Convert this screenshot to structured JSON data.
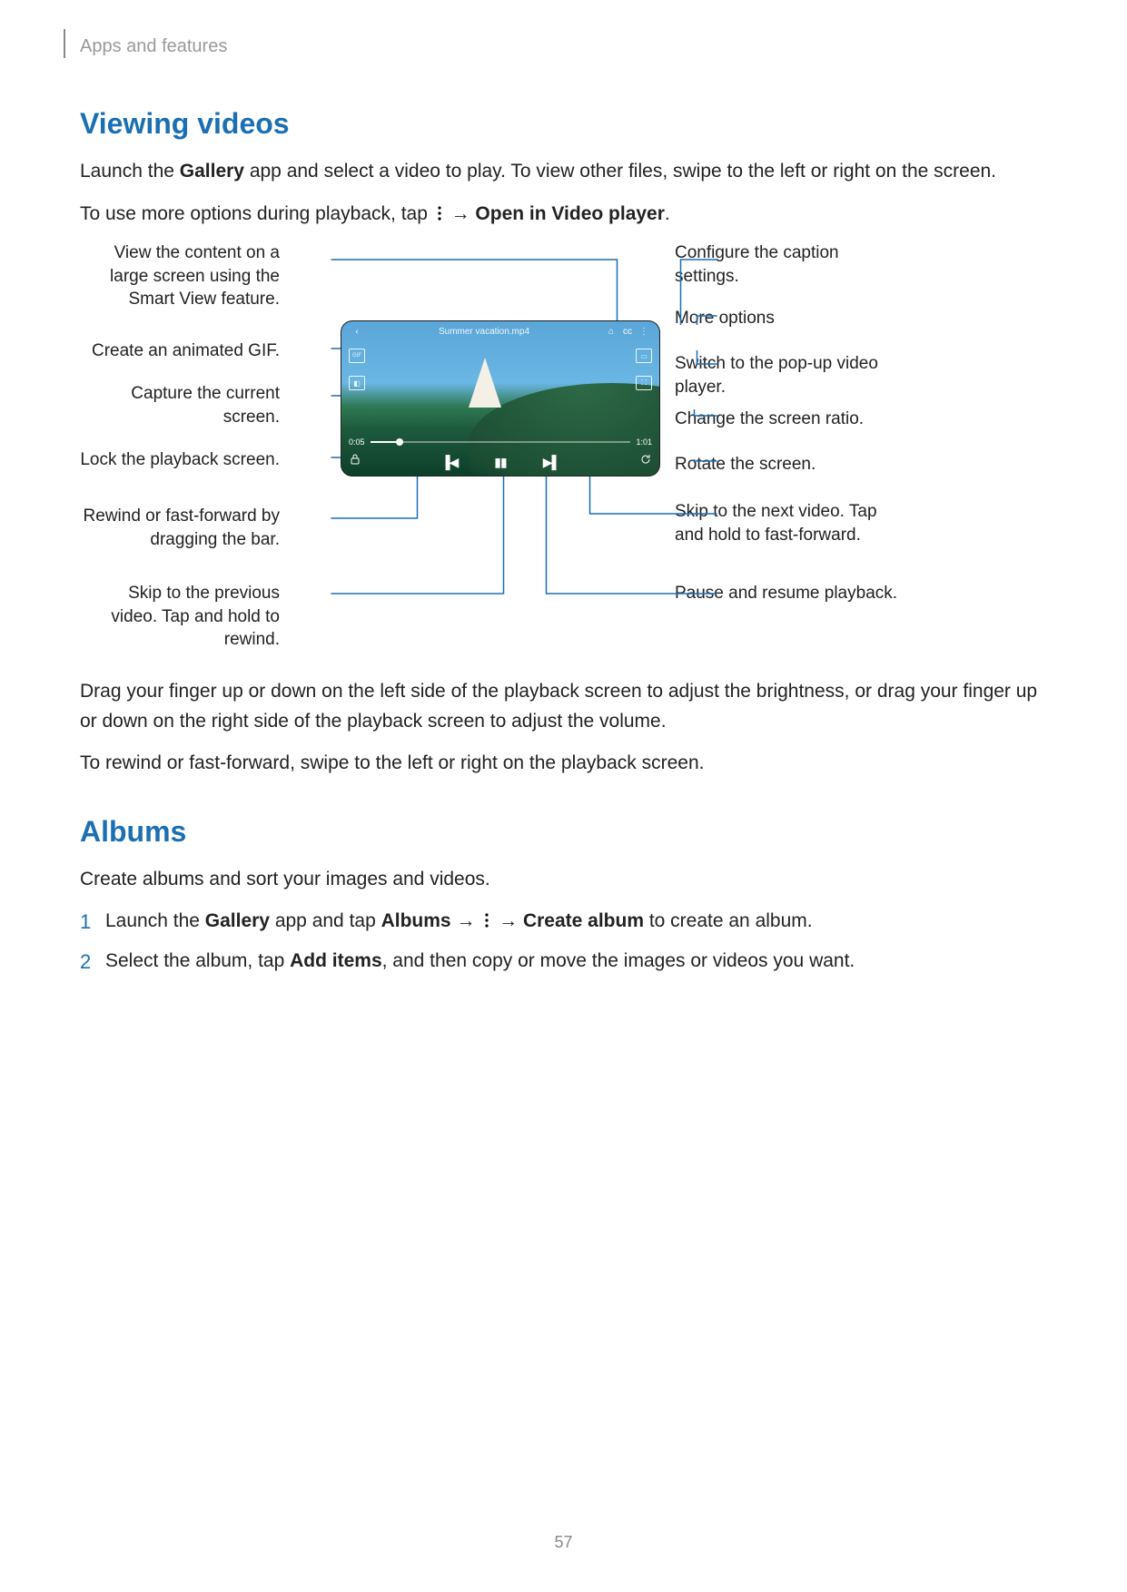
{
  "header": {
    "section_path": "Apps and features"
  },
  "page_number": "57",
  "viewing": {
    "heading": "Viewing videos",
    "intro_pre": "Launch the ",
    "intro_app": "Gallery",
    "intro_post": " app and select a video to play. To view other files, swipe to the left or right on the screen.",
    "options_pre": "To use more options during playback, tap ",
    "options_arrow": " → ",
    "options_bold": "Open in Video player",
    "options_end": ".",
    "after1": "Drag your finger up or down on the left side of the playback screen to adjust the brightness, or drag your finger up or down on the right side of the playback screen to adjust the volume.",
    "after2": "To rewind or fast-forward, swipe to the left or right on the playback screen."
  },
  "player": {
    "filename": "Summer vacation.mp4",
    "time_current": "0:05",
    "time_total": "1:01"
  },
  "callouts": {
    "left": {
      "smartview": "View the content on a large screen using the Smart View feature.",
      "gif": "Create an animated GIF.",
      "capture": "Capture the current screen.",
      "lock": "Lock the playback screen.",
      "seek": "Rewind or fast-forward by dragging the bar.",
      "prev": "Skip to the previous video. Tap and hold to rewind."
    },
    "right": {
      "caption": "Configure the caption settings.",
      "more": "More options",
      "pip": "Switch to the pop-up video player.",
      "ratio": "Change the screen ratio.",
      "rotate": "Rotate the screen.",
      "next": "Skip to the next video. Tap and hold to fast-forward.",
      "pause": "Pause and resume playback."
    }
  },
  "albums": {
    "heading": "Albums",
    "intro": "Create albums and sort your images and videos.",
    "step1_pre": "Launch the ",
    "step1_app": "Gallery",
    "step1_mid1": " app and tap ",
    "step1_albums": "Albums",
    "step1_arrow1": " → ",
    "step1_arrow2": " → ",
    "step1_create": "Create album",
    "step1_post": " to create an album.",
    "step2_pre": "Select the album, tap ",
    "step2_add": "Add items",
    "step2_post": ", and then copy or move the images or videos you want."
  }
}
